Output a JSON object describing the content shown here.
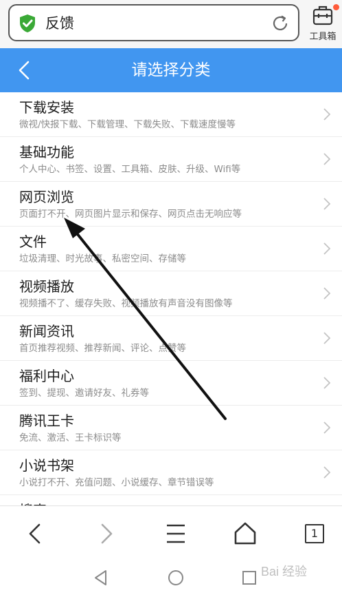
{
  "address_bar": {
    "text": "反馈",
    "shield_color": "#3aa936"
  },
  "toolbox": {
    "label": "工具箱",
    "icon": "toolbox-icon"
  },
  "header": {
    "title": "请选择分类",
    "bg_color": "#4196f0"
  },
  "categories": [
    {
      "title": "下载安装",
      "desc": "微视/快报下载、下载管理、下载失败、下载速度慢等"
    },
    {
      "title": "基础功能",
      "desc": "个人中心、书签、设置、工具箱、皮肤、升级、Wifi等"
    },
    {
      "title": "网页浏览",
      "desc": "页面打不开、网页图片显示和保存、网页点击无响应等"
    },
    {
      "title": "文件",
      "desc": "垃圾清理、时光故事、私密空间、存储等"
    },
    {
      "title": "视频播放",
      "desc": "视频播不了、缓存失败、视频播放有声音没有图像等"
    },
    {
      "title": "新闻资讯",
      "desc": "首页推荐视频、推荐新闻、评论、点赞等"
    },
    {
      "title": "福利中心",
      "desc": "签到、提现、邀请好友、礼券等"
    },
    {
      "title": "腾讯王卡",
      "desc": "免流、激活、王卡标识等"
    },
    {
      "title": "小说书架",
      "desc": "小说打不开、充值问题、小说缓存、章节错误等"
    },
    {
      "title": "搜索",
      "desc": ""
    }
  ],
  "bottom_nav": {
    "tab_count": "1"
  },
  "watermark": "Bai 经验"
}
